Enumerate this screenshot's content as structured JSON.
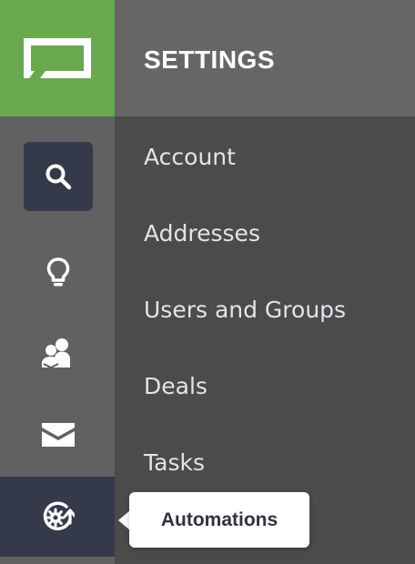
{
  "app": {
    "brand_color": "#6aa84f",
    "logo_icon": "brand-logo-icon"
  },
  "header": {
    "title": "SETTINGS"
  },
  "rail": {
    "items": [
      {
        "name": "search",
        "icon": "search-icon",
        "selected": true
      },
      {
        "name": "ideas",
        "icon": "lightbulb-icon",
        "selected": false
      },
      {
        "name": "contacts",
        "icon": "contacts-icon",
        "selected": false
      },
      {
        "name": "mail",
        "icon": "envelope-icon",
        "selected": false
      },
      {
        "name": "automations",
        "icon": "automations-icon",
        "selected": true
      }
    ]
  },
  "menu": {
    "items": [
      {
        "label": "Account"
      },
      {
        "label": "Addresses"
      },
      {
        "label": "Users and Groups"
      },
      {
        "label": "Deals"
      },
      {
        "label": "Tasks"
      }
    ]
  },
  "tooltip": {
    "text": "Automations"
  }
}
